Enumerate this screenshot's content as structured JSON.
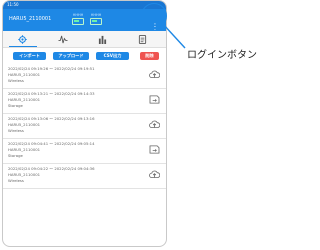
{
  "status_bar": {
    "time": "11:50",
    "right_text": ""
  },
  "header": {
    "device_name": "HARU5_2110001",
    "indicators": [
      {
        "label": "HHHH"
      },
      {
        "label": "HHHH"
      }
    ]
  },
  "tabs": [
    {
      "name": "gear-icon"
    },
    {
      "name": "wave-icon"
    },
    {
      "name": "bar-chart-icon"
    },
    {
      "name": "document-icon"
    }
  ],
  "actions": {
    "import_label": "インポート",
    "upload_label": "アップロード",
    "csv_label": "CSV出力",
    "delete_label": "削除"
  },
  "list": [
    {
      "range": "2022/02/24 09:19:26 ～ 2022/02/24 09:19:51",
      "device": "HARU5_2110001",
      "type": "Wireless",
      "icon": "cloud-upload-icon"
    },
    {
      "range": "2022/02/24 09:13:21 ～ 2022/02/24 09:14:33",
      "device": "HARU5_2110001",
      "type": "Storage",
      "icon": "sd-card-icon"
    },
    {
      "range": "2022/02/24 09:13:06 ～ 2022/02/24 09:13:16",
      "device": "HARU5_2110001",
      "type": "Wireless",
      "icon": "cloud-upload-icon"
    },
    {
      "range": "2022/02/24 09:04:41 ～ 2022/02/24 09:05:14",
      "device": "HARU5_2110001",
      "type": "Storage",
      "icon": "sd-card-icon"
    },
    {
      "range": "2022/02/24 09:04:22 ～ 2022/02/24 09:04:36",
      "device": "HARU5_2110001",
      "type": "Wireless",
      "icon": "cloud-upload-icon"
    }
  ],
  "callout": {
    "label": "ログインボタン"
  },
  "colors": {
    "primary": "#1e88e5",
    "danger": "#ef5350"
  }
}
